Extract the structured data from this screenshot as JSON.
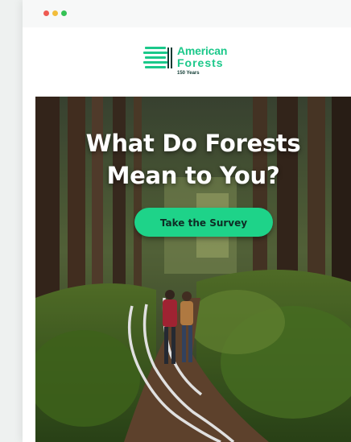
{
  "window": {
    "controls": [
      "close",
      "minimize",
      "maximize"
    ]
  },
  "brand": {
    "name_line1": "American",
    "name_line2": "Forests",
    "tagline": "150 Years",
    "accent_color": "#1bc88a",
    "icon": "tree-stripes-logo-icon"
  },
  "hero": {
    "headline_line1": "What Do Forests",
    "headline_line2": "Mean to You?",
    "cta_label": "Take the Survey",
    "cta_color": "#1ed389",
    "image": "hikers-on-forest-trail-photo"
  }
}
